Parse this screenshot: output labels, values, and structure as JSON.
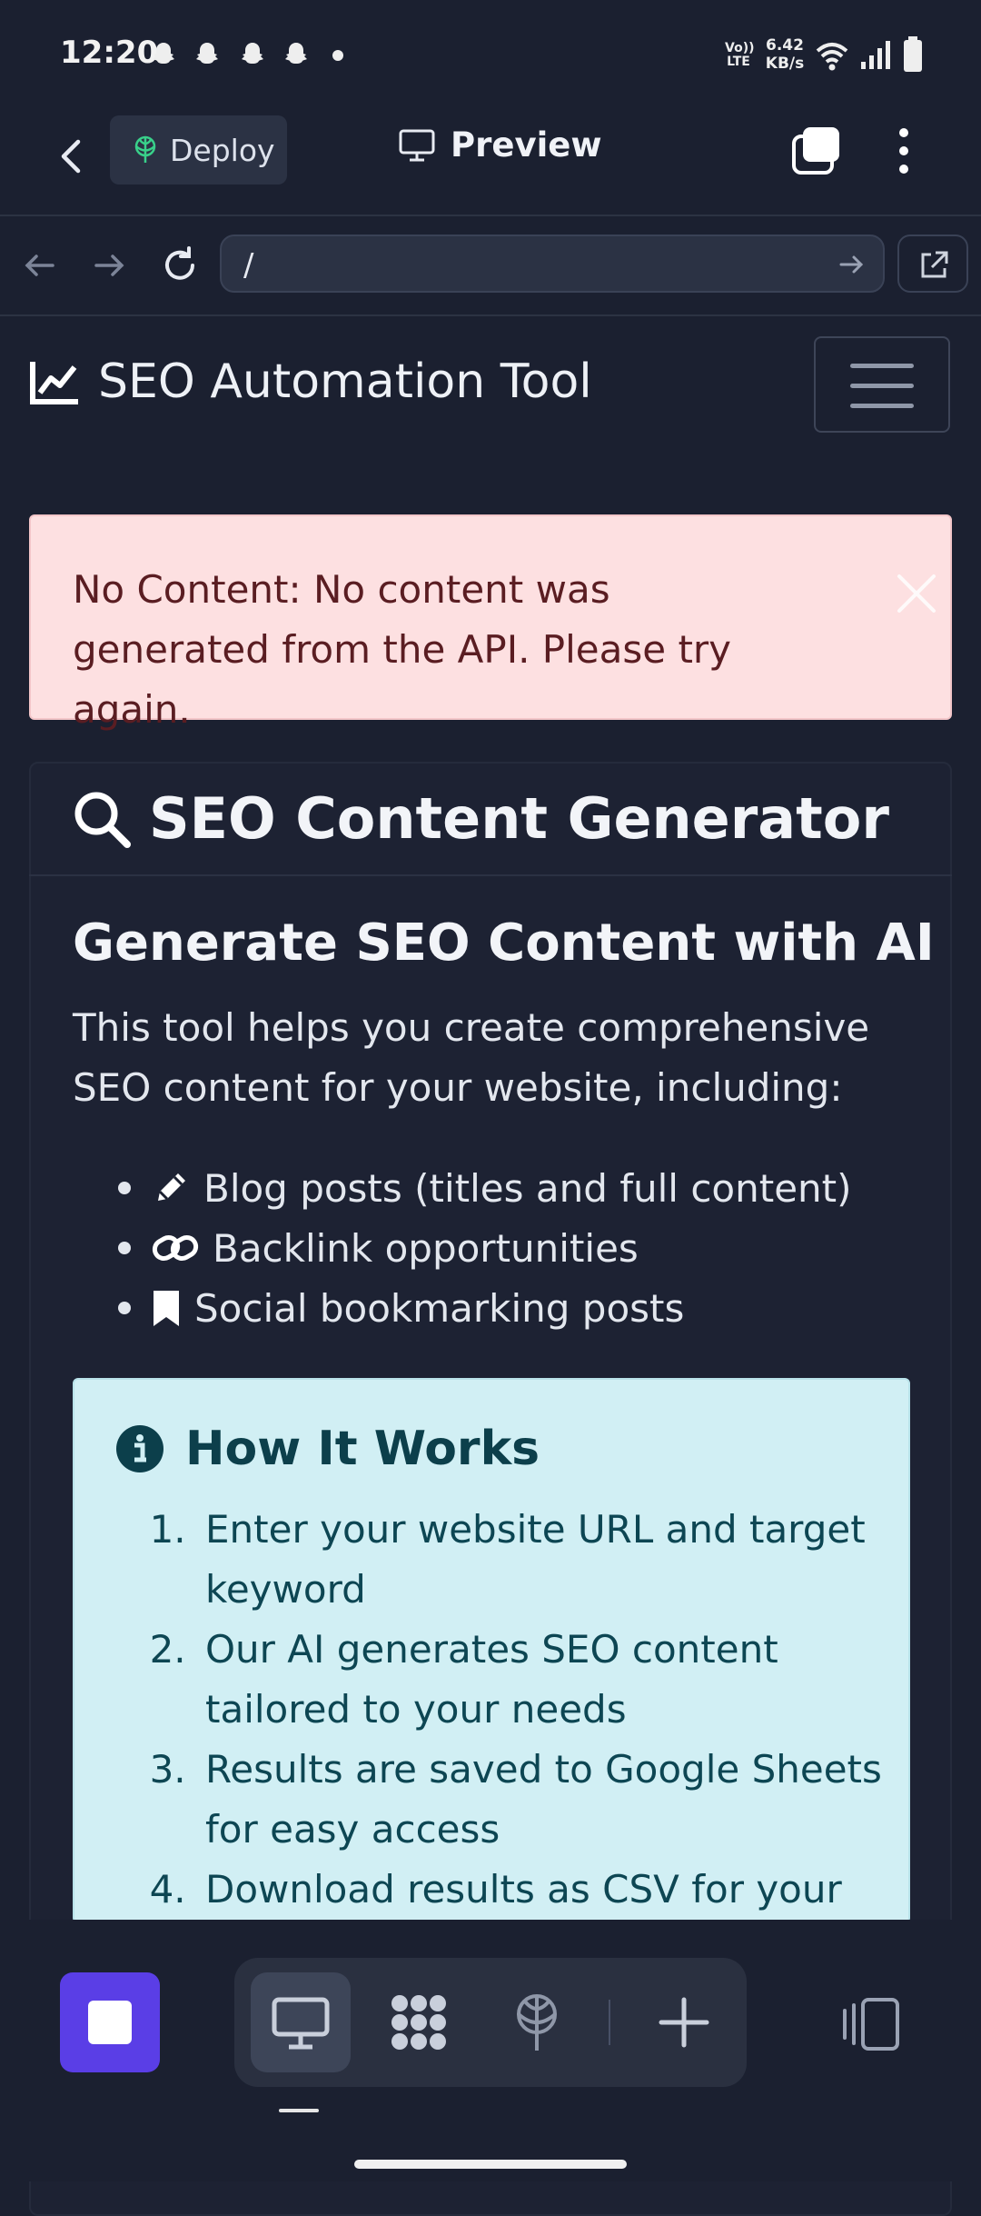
{
  "status_bar": {
    "time": "12:20",
    "network_label": "Vo)) LTE",
    "speed": "6.42 KB/s"
  },
  "app_bar": {
    "deploy_label": "Deploy",
    "preview_label": "Preview"
  },
  "url_bar": {
    "value": "/"
  },
  "site": {
    "brand": "SEO Automation Tool",
    "alert": "No Content: No content was generated from the API. Please try again.",
    "card_title": "SEO Content Generator",
    "heading": "Generate SEO Content with AI",
    "intro": "This tool helps you create comprehensive SEO content for your website, including:",
    "features": [
      {
        "icon": "pencil-icon",
        "label": "Blog posts (titles and full content)"
      },
      {
        "icon": "link-icon",
        "label": "Backlink opportunities"
      },
      {
        "icon": "bookmark-icon",
        "label": "Social bookmarking posts"
      }
    ],
    "how_it_works": {
      "title": "How It Works",
      "steps": [
        "Enter your website URL and target keyword",
        "Our AI generates SEO content tailored to your needs",
        "Results are saved to Google Sheets for easy access",
        "Download results as CSV for your"
      ]
    }
  },
  "colors": {
    "background": "#1b2030",
    "alert_bg": "#fde0e1",
    "alert_text": "#5a1d22",
    "info_bg": "#d1eff4",
    "info_text": "#0d4653",
    "accent": "#5a3ee6"
  }
}
